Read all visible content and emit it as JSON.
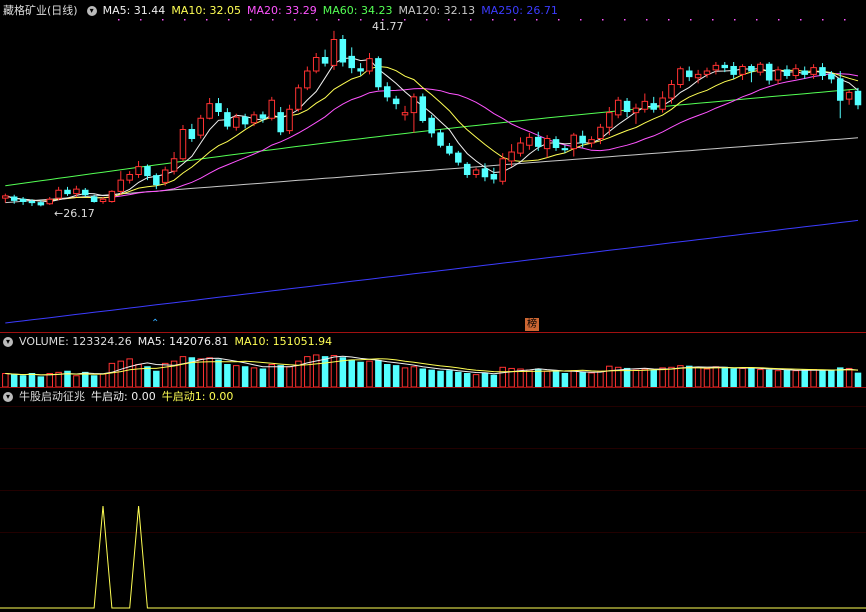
{
  "colors": {
    "up": "#ff3232",
    "down": "#54ffff",
    "ma5": "#f0f0f0",
    "ma10": "#ffff54",
    "ma20": "#ff54ff",
    "ma60": "#54ff54",
    "ma120": "#c8c8c8",
    "ma250": "#3c3cff",
    "signal": "#ffff54"
  },
  "main": {
    "title": "藏格矿业(日线)",
    "legend": [
      {
        "text": "MA5: 31.44",
        "color": "#f0f0f0"
      },
      {
        "text": "MA10: 32.05",
        "color": "#ffff54"
      },
      {
        "text": "MA20: 33.29",
        "color": "#ff54ff"
      },
      {
        "text": "MA60: 34.23",
        "color": "#54ff54"
      },
      {
        "text": "MA120: 32.13",
        "color": "#c8c8c8"
      },
      {
        "text": "MA250: 26.71",
        "color": "#3c3cff"
      }
    ],
    "high_label": "41.77",
    "low_label": "←26.17",
    "badge": "榜",
    "up_marker": "⌃"
  },
  "volume": {
    "legend": [
      {
        "text": "VOLUME: 123324.26",
        "color": "#dddddd"
      },
      {
        "text": "MA5: 142076.81",
        "color": "#f0f0f0"
      },
      {
        "text": "MA10: 151051.94",
        "color": "#ffff54"
      }
    ]
  },
  "indicator": {
    "legend": [
      {
        "text": "牛股启动征兆",
        "color": "#dddddd"
      },
      {
        "text": "牛启动: 0.00",
        "color": "#f0f0f0"
      },
      {
        "text": "牛启动1: 0.00",
        "color": "#ffff54"
      }
    ]
  },
  "chart_data": {
    "type": "candlestick",
    "price_range": [
      15,
      43
    ],
    "candles": [
      [
        26.9,
        27.1,
        26.5,
        27.3
      ],
      [
        27.0,
        26.7,
        26.4,
        27.2
      ],
      [
        26.8,
        26.6,
        26.3,
        27.0
      ],
      [
        26.6,
        26.5,
        26.2,
        26.8
      ],
      [
        26.5,
        26.3,
        26.17,
        26.7
      ],
      [
        26.4,
        26.8,
        26.3,
        27.0
      ],
      [
        26.9,
        27.6,
        26.7,
        27.9
      ],
      [
        27.6,
        27.3,
        27.1,
        27.9
      ],
      [
        27.3,
        27.7,
        27.0,
        28.0
      ],
      [
        27.6,
        27.2,
        27.0,
        27.8
      ],
      [
        27.0,
        26.6,
        26.5,
        27.2
      ],
      [
        26.6,
        26.8,
        26.4,
        27.0
      ],
      [
        26.6,
        27.5,
        26.5,
        27.6
      ],
      [
        27.5,
        28.5,
        27.2,
        29.3
      ],
      [
        28.5,
        29.0,
        28.2,
        29.3
      ],
      [
        29.0,
        29.7,
        28.7,
        30.2
      ],
      [
        29.7,
        28.9,
        28.5,
        29.9
      ],
      [
        28.9,
        28.1,
        27.7,
        29.1
      ],
      [
        28.3,
        29.4,
        28.0,
        29.7
      ],
      [
        29.3,
        30.4,
        29.0,
        31.0
      ],
      [
        30.4,
        33.0,
        30.2,
        33.4
      ],
      [
        33.0,
        32.2,
        31.9,
        33.5
      ],
      [
        32.5,
        34.0,
        32.2,
        34.3
      ],
      [
        34.0,
        35.3,
        33.9,
        35.8
      ],
      [
        35.3,
        34.6,
        34.2,
        35.8
      ],
      [
        34.5,
        33.3,
        33.0,
        34.9
      ],
      [
        33.2,
        34.1,
        32.9,
        34.4
      ],
      [
        34.1,
        33.5,
        33.1,
        34.4
      ],
      [
        33.6,
        34.3,
        33.3,
        34.6
      ],
      [
        34.3,
        34.0,
        33.6,
        34.6
      ],
      [
        34.0,
        35.6,
        33.8,
        35.9
      ],
      [
        34.5,
        32.8,
        32.5,
        35.0
      ],
      [
        32.9,
        34.8,
        32.6,
        35.2
      ],
      [
        34.8,
        36.7,
        34.6,
        37.0
      ],
      [
        36.7,
        38.2,
        36.5,
        38.6
      ],
      [
        38.2,
        39.4,
        38.0,
        39.8
      ],
      [
        39.4,
        38.9,
        38.6,
        40.1
      ],
      [
        38.7,
        41.0,
        38.3,
        41.77
      ],
      [
        41.0,
        39.0,
        38.6,
        41.4
      ],
      [
        39.5,
        38.5,
        38.0,
        40.3
      ],
      [
        38.4,
        38.2,
        37.8,
        38.9
      ],
      [
        38.2,
        39.3,
        37.9,
        39.8
      ],
      [
        39.3,
        36.8,
        36.5,
        39.5
      ],
      [
        36.8,
        35.9,
        35.5,
        37.2
      ],
      [
        35.7,
        35.3,
        34.8,
        36.0
      ],
      [
        34.3,
        34.5,
        33.8,
        35.1
      ],
      [
        34.5,
        35.9,
        32.7,
        36.2
      ],
      [
        35.9,
        33.8,
        33.6,
        36.2
      ],
      [
        34.0,
        32.7,
        32.3,
        34.3
      ],
      [
        32.7,
        31.6,
        31.4,
        33.0
      ],
      [
        31.5,
        30.9,
        30.7,
        31.8
      ],
      [
        30.9,
        30.1,
        29.8,
        31.1
      ],
      [
        29.9,
        29.0,
        28.7,
        30.1
      ],
      [
        29.0,
        29.4,
        28.7,
        29.6
      ],
      [
        29.5,
        28.8,
        28.4,
        30.0
      ],
      [
        29.0,
        28.6,
        28.2,
        29.6
      ],
      [
        28.4,
        30.4,
        28.1,
        30.9
      ],
      [
        30.2,
        31.0,
        29.7,
        31.7
      ],
      [
        30.9,
        31.8,
        30.6,
        32.3
      ],
      [
        31.6,
        32.3,
        31.2,
        32.7
      ],
      [
        32.3,
        31.5,
        31.1,
        32.8
      ],
      [
        31.3,
        32.2,
        30.5,
        32.5
      ],
      [
        32.1,
        31.4,
        31.1,
        32.4
      ],
      [
        31.3,
        31.2,
        30.9,
        31.6
      ],
      [
        31.3,
        32.5,
        30.6,
        32.7
      ],
      [
        32.4,
        31.8,
        31.4,
        32.9
      ],
      [
        31.8,
        32.1,
        31.4,
        32.4
      ],
      [
        32.2,
        33.2,
        31.7,
        33.5
      ],
      [
        33.2,
        34.5,
        32.5,
        35.0
      ],
      [
        34.3,
        35.6,
        34.0,
        35.9
      ],
      [
        35.5,
        34.6,
        34.1,
        35.8
      ],
      [
        34.5,
        34.9,
        33.5,
        35.3
      ],
      [
        34.8,
        35.5,
        34.5,
        36.2
      ],
      [
        35.3,
        34.8,
        34.5,
        35.9
      ],
      [
        34.8,
        35.8,
        34.5,
        36.4
      ],
      [
        35.8,
        37.0,
        35.3,
        37.4
      ],
      [
        37.0,
        38.4,
        36.7,
        38.6
      ],
      [
        38.2,
        37.7,
        37.3,
        38.6
      ],
      [
        37.6,
        37.9,
        37.1,
        38.3
      ],
      [
        37.9,
        38.2,
        37.6,
        38.5
      ],
      [
        38.3,
        38.7,
        37.9,
        39.0
      ],
      [
        38.7,
        38.5,
        38.1,
        39.0
      ],
      [
        38.6,
        37.9,
        37.5,
        39.0
      ],
      [
        37.9,
        38.6,
        37.4,
        38.8
      ],
      [
        38.6,
        38.2,
        37.2,
        38.8
      ],
      [
        38.1,
        38.8,
        37.8,
        39.0
      ],
      [
        38.8,
        37.4,
        37.0,
        39.0
      ],
      [
        37.4,
        38.3,
        37.0,
        38.6
      ],
      [
        38.3,
        37.8,
        37.5,
        38.7
      ],
      [
        37.8,
        38.4,
        37.5,
        38.8
      ],
      [
        38.2,
        37.9,
        37.5,
        38.6
      ],
      [
        37.9,
        38.5,
        37.5,
        38.8
      ],
      [
        38.5,
        37.8,
        37.4,
        38.9
      ],
      [
        37.9,
        37.5,
        37.1,
        38.2
      ],
      [
        37.5,
        35.6,
        34.0,
        38.2
      ],
      [
        35.7,
        36.3,
        35.2,
        36.5
      ],
      [
        36.4,
        35.2,
        34.8,
        36.7
      ]
    ],
    "volume_range": [
      0,
      320000
    ],
    "volume": [
      120000,
      110000,
      100000,
      120000,
      90000,
      120000,
      130000,
      140000,
      100000,
      130000,
      100000,
      115000,
      210000,
      230000,
      250000,
      200000,
      180000,
      140000,
      210000,
      230000,
      270000,
      260000,
      250000,
      260000,
      240000,
      200000,
      190000,
      180000,
      170000,
      160000,
      200000,
      190000,
      180000,
      230000,
      270000,
      285000,
      270000,
      280000,
      260000,
      240000,
      220000,
      230000,
      235000,
      200000,
      190000,
      170000,
      180000,
      160000,
      150000,
      140000,
      145000,
      130000,
      120000,
      110000,
      125000,
      105000,
      175000,
      165000,
      160000,
      150000,
      160000,
      140000,
      135000,
      120000,
      145000,
      130000,
      125000,
      140000,
      185000,
      175000,
      165000,
      150000,
      160000,
      150000,
      170000,
      175000,
      190000,
      185000,
      175000,
      160000,
      180000,
      175000,
      160000,
      165000,
      170000,
      155000,
      150000,
      145000,
      150000,
      145000,
      150000,
      155000,
      150000,
      145000,
      170000,
      165000,
      123324
    ],
    "signal_range": [
      0,
      1
    ],
    "signal_spikes": [
      [
        11,
        1
      ],
      [
        15,
        1
      ]
    ],
    "signal_values": "牛启动: 0.00, 牛启动1: 0.00"
  }
}
